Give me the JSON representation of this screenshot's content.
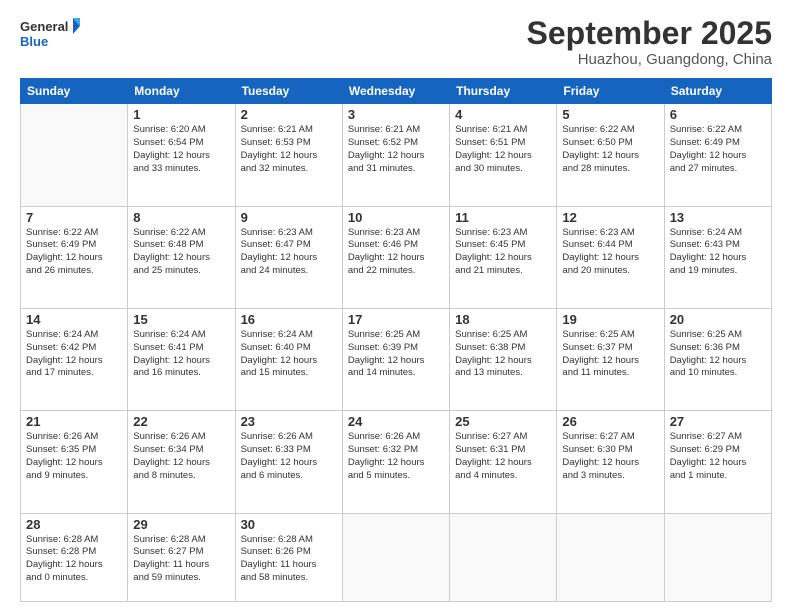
{
  "header": {
    "logo_line1": "General",
    "logo_line2": "Blue",
    "month": "September 2025",
    "location": "Huazhou, Guangdong, China"
  },
  "weekdays": [
    "Sunday",
    "Monday",
    "Tuesday",
    "Wednesday",
    "Thursday",
    "Friday",
    "Saturday"
  ],
  "weeks": [
    [
      {
        "day": "",
        "info": ""
      },
      {
        "day": "1",
        "info": "Sunrise: 6:20 AM\nSunset: 6:54 PM\nDaylight: 12 hours\nand 33 minutes."
      },
      {
        "day": "2",
        "info": "Sunrise: 6:21 AM\nSunset: 6:53 PM\nDaylight: 12 hours\nand 32 minutes."
      },
      {
        "day": "3",
        "info": "Sunrise: 6:21 AM\nSunset: 6:52 PM\nDaylight: 12 hours\nand 31 minutes."
      },
      {
        "day": "4",
        "info": "Sunrise: 6:21 AM\nSunset: 6:51 PM\nDaylight: 12 hours\nand 30 minutes."
      },
      {
        "day": "5",
        "info": "Sunrise: 6:22 AM\nSunset: 6:50 PM\nDaylight: 12 hours\nand 28 minutes."
      },
      {
        "day": "6",
        "info": "Sunrise: 6:22 AM\nSunset: 6:49 PM\nDaylight: 12 hours\nand 27 minutes."
      }
    ],
    [
      {
        "day": "7",
        "info": "Sunrise: 6:22 AM\nSunset: 6:49 PM\nDaylight: 12 hours\nand 26 minutes."
      },
      {
        "day": "8",
        "info": "Sunrise: 6:22 AM\nSunset: 6:48 PM\nDaylight: 12 hours\nand 25 minutes."
      },
      {
        "day": "9",
        "info": "Sunrise: 6:23 AM\nSunset: 6:47 PM\nDaylight: 12 hours\nand 24 minutes."
      },
      {
        "day": "10",
        "info": "Sunrise: 6:23 AM\nSunset: 6:46 PM\nDaylight: 12 hours\nand 22 minutes."
      },
      {
        "day": "11",
        "info": "Sunrise: 6:23 AM\nSunset: 6:45 PM\nDaylight: 12 hours\nand 21 minutes."
      },
      {
        "day": "12",
        "info": "Sunrise: 6:23 AM\nSunset: 6:44 PM\nDaylight: 12 hours\nand 20 minutes."
      },
      {
        "day": "13",
        "info": "Sunrise: 6:24 AM\nSunset: 6:43 PM\nDaylight: 12 hours\nand 19 minutes."
      }
    ],
    [
      {
        "day": "14",
        "info": "Sunrise: 6:24 AM\nSunset: 6:42 PM\nDaylight: 12 hours\nand 17 minutes."
      },
      {
        "day": "15",
        "info": "Sunrise: 6:24 AM\nSunset: 6:41 PM\nDaylight: 12 hours\nand 16 minutes."
      },
      {
        "day": "16",
        "info": "Sunrise: 6:24 AM\nSunset: 6:40 PM\nDaylight: 12 hours\nand 15 minutes."
      },
      {
        "day": "17",
        "info": "Sunrise: 6:25 AM\nSunset: 6:39 PM\nDaylight: 12 hours\nand 14 minutes."
      },
      {
        "day": "18",
        "info": "Sunrise: 6:25 AM\nSunset: 6:38 PM\nDaylight: 12 hours\nand 13 minutes."
      },
      {
        "day": "19",
        "info": "Sunrise: 6:25 AM\nSunset: 6:37 PM\nDaylight: 12 hours\nand 11 minutes."
      },
      {
        "day": "20",
        "info": "Sunrise: 6:25 AM\nSunset: 6:36 PM\nDaylight: 12 hours\nand 10 minutes."
      }
    ],
    [
      {
        "day": "21",
        "info": "Sunrise: 6:26 AM\nSunset: 6:35 PM\nDaylight: 12 hours\nand 9 minutes."
      },
      {
        "day": "22",
        "info": "Sunrise: 6:26 AM\nSunset: 6:34 PM\nDaylight: 12 hours\nand 8 minutes."
      },
      {
        "day": "23",
        "info": "Sunrise: 6:26 AM\nSunset: 6:33 PM\nDaylight: 12 hours\nand 6 minutes."
      },
      {
        "day": "24",
        "info": "Sunrise: 6:26 AM\nSunset: 6:32 PM\nDaylight: 12 hours\nand 5 minutes."
      },
      {
        "day": "25",
        "info": "Sunrise: 6:27 AM\nSunset: 6:31 PM\nDaylight: 12 hours\nand 4 minutes."
      },
      {
        "day": "26",
        "info": "Sunrise: 6:27 AM\nSunset: 6:30 PM\nDaylight: 12 hours\nand 3 minutes."
      },
      {
        "day": "27",
        "info": "Sunrise: 6:27 AM\nSunset: 6:29 PM\nDaylight: 12 hours\nand 1 minute."
      }
    ],
    [
      {
        "day": "28",
        "info": "Sunrise: 6:28 AM\nSunset: 6:28 PM\nDaylight: 12 hours\nand 0 minutes."
      },
      {
        "day": "29",
        "info": "Sunrise: 6:28 AM\nSunset: 6:27 PM\nDaylight: 11 hours\nand 59 minutes."
      },
      {
        "day": "30",
        "info": "Sunrise: 6:28 AM\nSunset: 6:26 PM\nDaylight: 11 hours\nand 58 minutes."
      },
      {
        "day": "",
        "info": ""
      },
      {
        "day": "",
        "info": ""
      },
      {
        "day": "",
        "info": ""
      },
      {
        "day": "",
        "info": ""
      }
    ]
  ]
}
